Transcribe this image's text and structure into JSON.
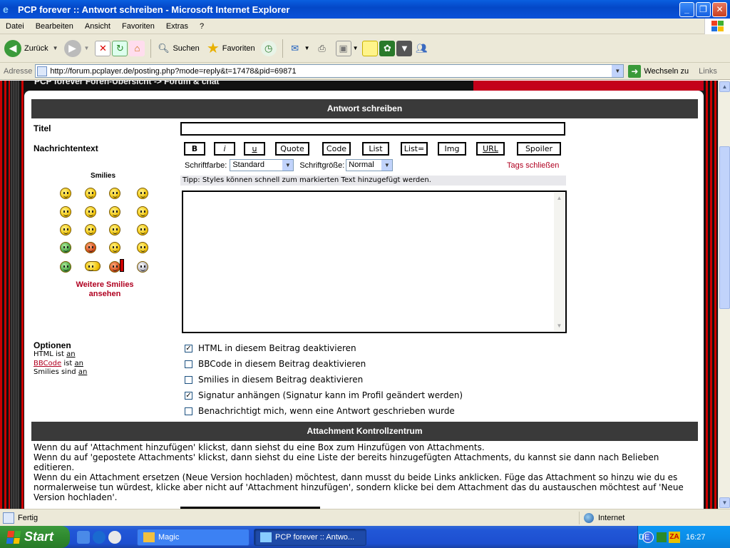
{
  "window": {
    "title": "PCP forever :: Antwort schreiben - Microsoft Internet Explorer"
  },
  "menu": [
    "Datei",
    "Bearbeiten",
    "Ansicht",
    "Favoriten",
    "Extras",
    "?"
  ],
  "toolbar": {
    "back": "Zurück",
    "search": "Suchen",
    "favorites": "Favoriten"
  },
  "address": {
    "label": "Adresse",
    "url": "http://forum.pcplayer.de/posting.php?mode=reply&t=17478&pid=69871",
    "go": "Wechseln zu",
    "links": "Links"
  },
  "page": {
    "breadcrumb": "PCP forever Foren-Übersicht -> Forum & chat",
    "header": "Antwort schreiben",
    "title_label": "Titel",
    "message_label": "Nachrichtentext",
    "bbcode_buttons": [
      "B",
      "i",
      "u",
      "Quote",
      "Code",
      "List",
      "List=",
      "Img",
      "URL",
      "Spoiler"
    ],
    "font_color_label": "Schriftfarbe:",
    "font_color_value": "Standard",
    "font_size_label": "Schriftgröße:",
    "font_size_value": "Normal",
    "close_tags": "Tags schließen",
    "tip": "Tipp: Styles können schnell zum markierten Text hinzugefügt werden.",
    "smilies_title": "Smilies",
    "more_smilies": "Weitere Smilies ansehen",
    "options_title": "Optionen",
    "html_status_prefix": "HTML ist ",
    "html_status": "an",
    "bbcode_label": "BBCode",
    "bbcode_status_prefix": " ist ",
    "bbcode_status": "an",
    "smilies_status_prefix": "Smilies sind ",
    "smilies_status": "an",
    "options": [
      {
        "label": "HTML in diesem Beitrag deaktivieren",
        "checked": true
      },
      {
        "label": "BBCode in diesem Beitrag deaktivieren",
        "checked": false
      },
      {
        "label": "Smilies in diesem Beitrag deaktivieren",
        "checked": false
      },
      {
        "label": "Signatur anhängen (Signatur kann im Profil geändert werden)",
        "checked": true
      },
      {
        "label": "Benachrichtigt mich, wenn eine Antwort geschrieben wurde",
        "checked": false
      }
    ],
    "attachment_header": "Attachment Kontrollzentrum",
    "attachment_text": [
      "Wenn du auf 'Attachment hinzufügen' klickst, dann siehst du eine Box zum Hinzufügen von Attachments.",
      "Wenn du auf 'gepostete Attachments' klickst, dann siehst du eine Liste der bereits hinzugefügten Attachments, du kannst sie dann nach Belieben editieren.",
      "Wenn du ein Attachment ersetzen (Neue Version hochladen) möchtest, dann musst du beide Links anklicken. Füge das Attachment so hinzu wie du es normalerweise tun würdest, klicke aber nicht auf 'Attachment hinzufügen', sondern klicke bei dem Attachment das du austauschen möchtest auf 'Neue Version hochladen'."
    ]
  },
  "status": {
    "text": "Fertig",
    "zone": "Internet"
  },
  "taskbar": {
    "start": "Start",
    "tasks": [
      "Magic",
      "PCP forever :: Antwo..."
    ],
    "lang": "DE",
    "clock": "16:27"
  }
}
